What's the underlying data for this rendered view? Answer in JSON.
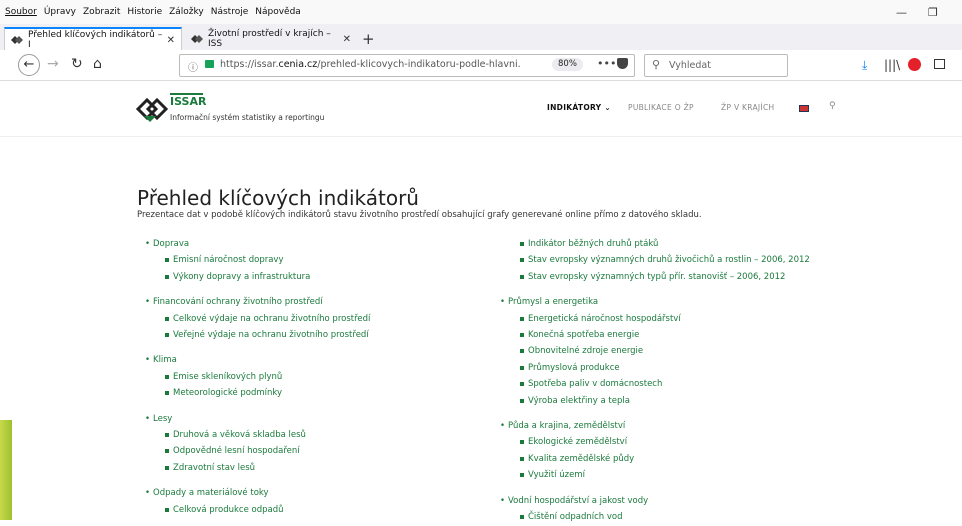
{
  "menubar": {
    "items": [
      "Soubor",
      "Úpravy",
      "Zobrazit",
      "Historie",
      "Záložky",
      "Nástroje",
      "Nápověda"
    ]
  },
  "tabs": [
    {
      "label": "Přehled klíčových indikátorů – I",
      "active": true
    },
    {
      "label": "Životní prostředí v krajích – ISS",
      "active": false
    }
  ],
  "navbar": {
    "url_prefix": "https://issar.",
    "url_domain": "cenia.cz",
    "url_path": "/prehled-klicovych-indikatoru-podle-hlavni...",
    "zoom": "80%",
    "search_placeholder": "Vyhledat"
  },
  "site": {
    "logo_name": "ISSAR",
    "logo_sub": "Informační systém statistiky a reportingu",
    "nav": [
      "INDIKÁTORY ⌄",
      "PUBLIKACE O ŽP",
      "ŽP V KRAJÍCH"
    ]
  },
  "main": {
    "title": "Přehled klíčových indikátorů",
    "intro": "Prezentace dat v podobě klíčových indikátorů stavu životního prostředí obsahující grafy generevané online přímo z datového skladu.",
    "left_column": [
      {
        "label": "Doprava",
        "items": [
          "Emisní náročnost dopravy",
          "Výkony dopravy a infrastruktura"
        ]
      },
      {
        "label": "Financování ochrany životního prostředí",
        "items": [
          "Celkové výdaje na ochranu životního prostředí",
          "Veřejné výdaje na ochranu životního prostředí"
        ]
      },
      {
        "label": "Klima",
        "items": [
          "Emise skleníkových plynů",
          "Meteorologické podmínky"
        ]
      },
      {
        "label": "Lesy",
        "items": [
          "Druhová a věková skladba lesů",
          "Odpovědné lesní hospodaření",
          "Zdravotní stav lesů"
        ]
      },
      {
        "label": "Odpady a materiálové toky",
        "items": [
          "Celková produkce odpadů"
        ]
      }
    ],
    "right_column_top": [
      "Indikátor běžných druhů ptáků",
      "Stav evropsky významných druhů živočichů a rostlin – 2006, 2012",
      "Stav evropsky významných typů přír. stanovišť – 2006, 2012"
    ],
    "right_column": [
      {
        "label": "Průmysl a energetika",
        "items": [
          "Energetická náročnost hospodářství",
          "Konečná spotřeba energie",
          "Obnovitelné zdroje energie",
          "Průmyslová produkce",
          "Spotřeba paliv v domácnostech",
          "Výroba elektřiny a tepla"
        ]
      },
      {
        "label": "Půda a krajina, zemědělství",
        "items": [
          "Ekologické zemědělství",
          "Kvalita zemědělské půdy",
          "Využití území"
        ]
      },
      {
        "label": "Vodní hospodářství a jakost vody",
        "items": [
          "Čištění odpadních vod"
        ]
      }
    ]
  }
}
